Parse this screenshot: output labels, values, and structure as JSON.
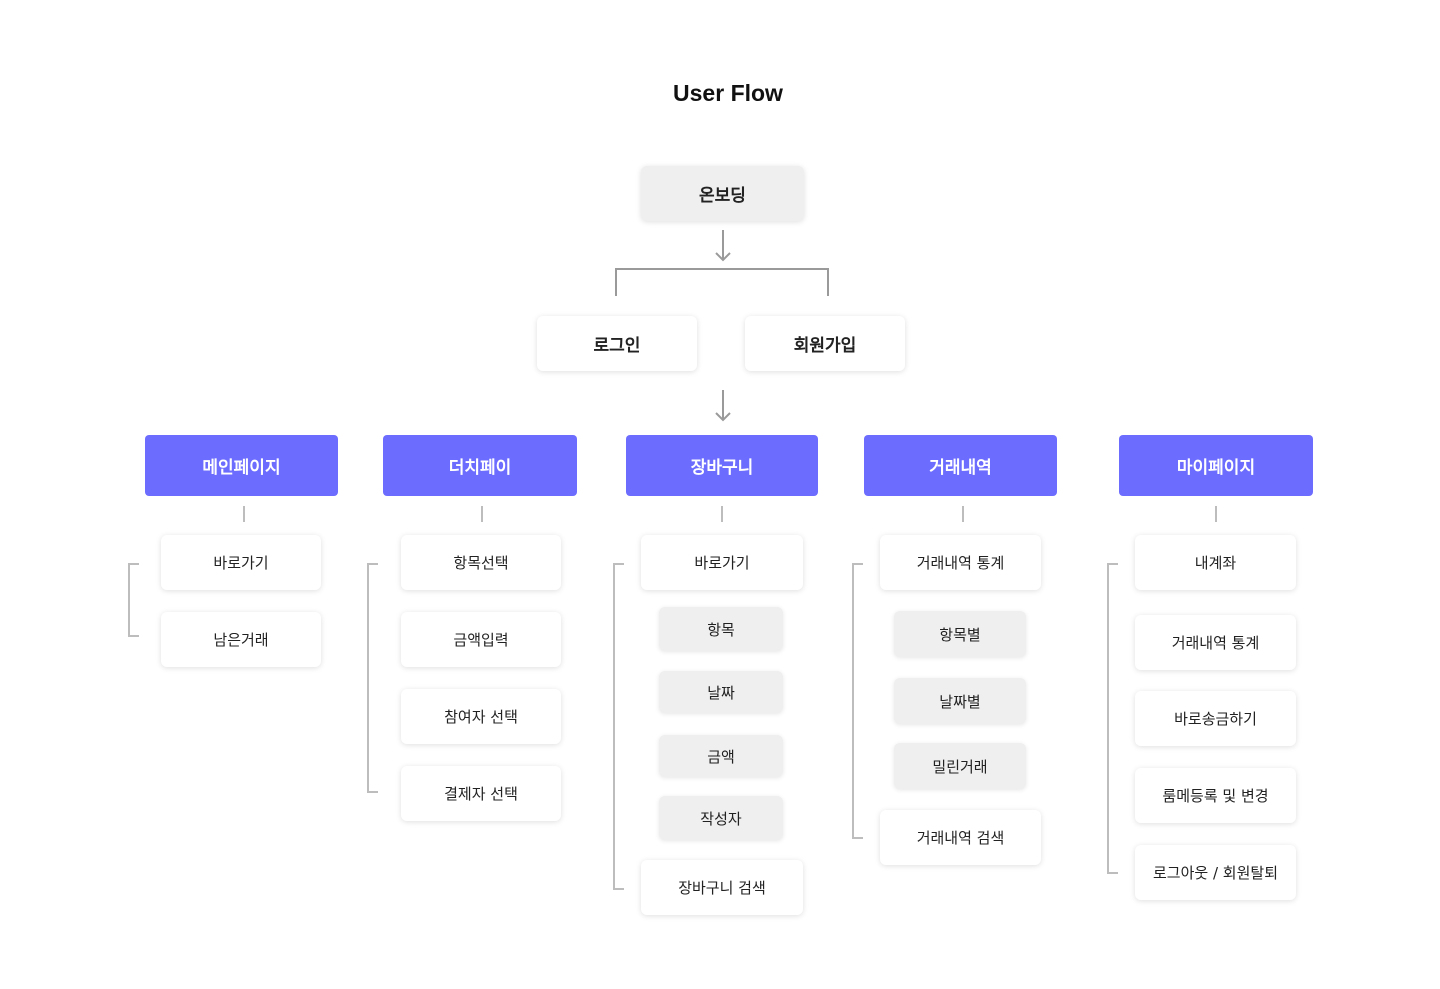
{
  "title": "User Flow",
  "onboarding": "온보딩",
  "auth": [
    "로그인",
    "회원가입"
  ],
  "colors": {
    "accent": "#6c6cff",
    "node_gray": "#efefef",
    "line": "#9a9a9a"
  },
  "sections": [
    {
      "label": "메인페이지",
      "items": [
        "바로가기",
        "남은거래"
      ]
    },
    {
      "label": "더치페이",
      "items": [
        "항목선택",
        "금액입력",
        "참여자 선택",
        "결제자 선택"
      ]
    },
    {
      "label": "장바구니",
      "items": [
        "바로가기",
        "장바구니 검색"
      ],
      "sub_items": [
        "항목",
        "날짜",
        "금액",
        "작성자"
      ]
    },
    {
      "label": "거래내역",
      "items": [
        "거래내역 통계",
        "거래내역 검색"
      ],
      "sub_items": [
        "항목별",
        "날짜별",
        "밀린거래"
      ]
    },
    {
      "label": "마이페이지",
      "items": [
        "내계좌",
        "거래내역 통계",
        "바로송금하기",
        "룸메등록 및 변경",
        "로그아웃 / 회원탈퇴"
      ]
    }
  ]
}
